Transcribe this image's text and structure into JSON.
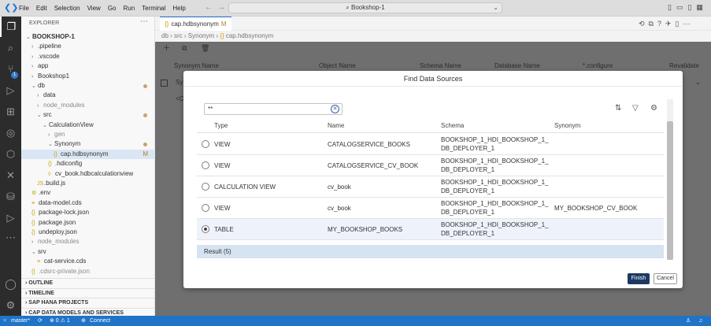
{
  "titlebar": {
    "menu": [
      "File",
      "Edit",
      "Selection",
      "View",
      "Go",
      "Run",
      "Terminal",
      "Help"
    ],
    "command_center": "Bookshop-1"
  },
  "activity": {
    "scm_badge": "1"
  },
  "explorer": {
    "title": "EXPLORER",
    "tree": [
      {
        "label": "BOOKSHOP-1",
        "indent": 0,
        "twisty": "v",
        "bold": true
      },
      {
        "label": ".pipeline",
        "indent": 1,
        "twisty": ">"
      },
      {
        "label": ".vscode",
        "indent": 1,
        "twisty": ">"
      },
      {
        "label": "app",
        "indent": 1,
        "twisty": ">"
      },
      {
        "label": "Bookshop1",
        "indent": 1,
        "twisty": ">"
      },
      {
        "label": "db",
        "indent": 1,
        "twisty": "v",
        "dot": true
      },
      {
        "label": "data",
        "indent": 2,
        "twisty": ">"
      },
      {
        "label": "node_modules",
        "indent": 2,
        "twisty": ">",
        "dim": true
      },
      {
        "label": "src",
        "indent": 2,
        "twisty": "v",
        "dot": true
      },
      {
        "label": "CalculationView",
        "indent": 3,
        "twisty": "v"
      },
      {
        "label": "gen",
        "indent": 4,
        "twisty": ">",
        "dim": true
      },
      {
        "label": "Synonym",
        "indent": 4,
        "twisty": "v",
        "dot": true
      },
      {
        "label": "cap.hdbsynonym",
        "indent": 5,
        "icon": "{}",
        "mark": "M",
        "selected": true
      },
      {
        "label": ".hdiconfig",
        "indent": 4,
        "icon": "{}"
      },
      {
        "label": "cv_book.hdbcalculationview",
        "indent": 4,
        "icon": "◊"
      },
      {
        "label": ".build.js",
        "indent": 2,
        "icon": "JS"
      },
      {
        "label": ".env",
        "indent": 1,
        "icon": "⚙"
      },
      {
        "label": "data-model.cds",
        "indent": 1,
        "icon": "≡"
      },
      {
        "label": "package-lock.json",
        "indent": 1,
        "icon": "{}"
      },
      {
        "label": "package.json",
        "indent": 1,
        "icon": "{}"
      },
      {
        "label": "undeploy.json",
        "indent": 1,
        "icon": "{}"
      },
      {
        "label": "node_modules",
        "indent": 1,
        "twisty": ">",
        "dim": true
      },
      {
        "label": "srv",
        "indent": 1,
        "twisty": "v"
      },
      {
        "label": "cat-service.cds",
        "indent": 2,
        "icon": "≡"
      },
      {
        "label": ".cdsrc-private.json",
        "indent": 1,
        "icon": "{}",
        "dim": true
      }
    ],
    "sections": [
      "OUTLINE",
      "TIMELINE",
      "SAP HANA PROJECTS",
      "CAP DATA MODELS AND SERVICES"
    ]
  },
  "editor": {
    "tab_label": "cap.hdbsynonym",
    "tab_modified": "M",
    "breadcrumb": [
      "db",
      "src",
      "Synonym",
      "cap.hdbsynonym"
    ],
    "grid_columns": [
      "Synonym Name",
      "Object Name",
      "Schema Name",
      "Database Name",
      "*.configure",
      "Revalidate"
    ],
    "grid_row_text": "Sy",
    "grid_row2_text": "<Cli"
  },
  "dialog": {
    "title": "Find Data Sources",
    "search_value": "**",
    "columns": [
      "Type",
      "Name",
      "Schema",
      "Synonym"
    ],
    "rows": [
      {
        "type": "VIEW",
        "name": "CATALOGSERVICE_BOOKS",
        "schema_line1": "BOOKSHOP_1_HDI_BOOKSHOP_1_",
        "schema_line2": "DB_DEPLOYER_1",
        "synonym": "",
        "selected": false
      },
      {
        "type": "VIEW",
        "name": "CATALOGSERVICE_CV_BOOK",
        "schema_line1": "BOOKSHOP_1_HDI_BOOKSHOP_1_",
        "schema_line2": "DB_DEPLOYER_1",
        "synonym": "",
        "selected": false
      },
      {
        "type": "CALCULATION VIEW",
        "name": "cv_book",
        "schema_line1": "BOOKSHOP_1_HDI_BOOKSHOP_1_",
        "schema_line2": "DB_DEPLOYER_1",
        "synonym": "",
        "selected": false
      },
      {
        "type": "VIEW",
        "name": "cv_book",
        "schema_line1": "BOOKSHOP_1_HDI_BOOKSHOP_1_",
        "schema_line2": "DB_DEPLOYER_1",
        "synonym": "MY_BOOKSHOP_CV_BOOK",
        "selected": false
      },
      {
        "type": "TABLE",
        "name": "MY_BOOKSHOP_BOOKS",
        "schema_line1": "BOOKSHOP_1_HDI_BOOKSHOP_1_",
        "schema_line2": "DB_DEPLOYER_1",
        "synonym": "",
        "selected": true
      }
    ],
    "result_text": "Result (5)",
    "finish_label": "Finish",
    "cancel_label": "Cancel"
  },
  "status": {
    "branch": "master*",
    "problems": "⊗ 0 ⚠ 1",
    "connect": "Connect"
  }
}
